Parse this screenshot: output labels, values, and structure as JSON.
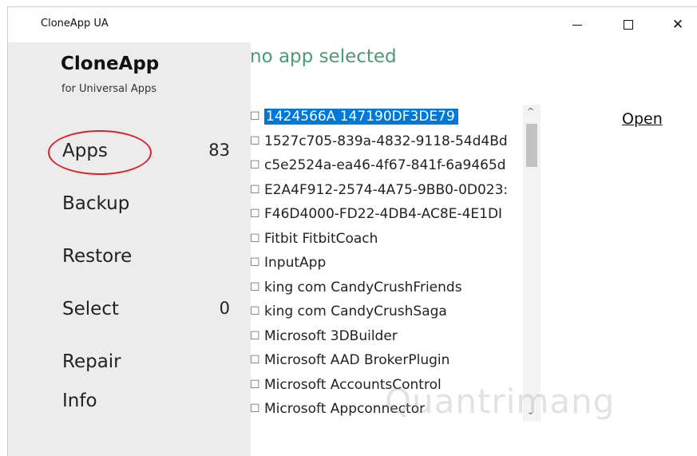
{
  "window": {
    "title": "CloneApp UA",
    "controls": {
      "minimize": "minimize-icon",
      "maximize": "maximize-icon",
      "close": "close-icon",
      "close_glyph": "✕"
    }
  },
  "sidebar": {
    "brand_title": "CloneApp",
    "brand_subtitle": "for Universal Apps",
    "items": [
      {
        "label": "Apps",
        "count": "83"
      },
      {
        "label": "Backup",
        "count": ""
      },
      {
        "label": "Restore",
        "count": ""
      },
      {
        "label": "Select",
        "count": "0"
      },
      {
        "label": "Repair",
        "count": ""
      },
      {
        "label": "Info",
        "count": ""
      }
    ],
    "highlight_color": "#d8222b"
  },
  "main": {
    "status": "no app selected",
    "status_color": "#4a9a78",
    "open_link": "Open",
    "checkbox_glyph": "☐",
    "scroll_up_glyph": "^",
    "scroll_down_glyph": "⌄",
    "apps": [
      {
        "label": "1424566A 147190DF3DE79",
        "selected": true,
        "checked": false
      },
      {
        "label": "1527c705-839a-4832-9118-54d4Bd",
        "selected": false,
        "checked": false
      },
      {
        "label": "c5e2524a-ea46-4f67-841f-6a9465d",
        "selected": false,
        "checked": false
      },
      {
        "label": "E2A4F912-2574-4A75-9BB0-0D023:",
        "selected": false,
        "checked": false
      },
      {
        "label": "F46D4000-FD22-4DB4-AC8E-4E1DI",
        "selected": false,
        "checked": false
      },
      {
        "label": "Fitbit FitbitCoach",
        "selected": false,
        "checked": false
      },
      {
        "label": "InputApp",
        "selected": false,
        "checked": false
      },
      {
        "label": "king com CandyCrushFriends",
        "selected": false,
        "checked": false
      },
      {
        "label": "king com CandyCrushSaga",
        "selected": false,
        "checked": false
      },
      {
        "label": "Microsoft 3DBuilder",
        "selected": false,
        "checked": false
      },
      {
        "label": "Microsoft AAD BrokerPlugin",
        "selected": false,
        "checked": false
      },
      {
        "label": "Microsoft AccountsControl",
        "selected": false,
        "checked": false
      },
      {
        "label": "Microsoft Appconnector",
        "selected": false,
        "checked": false
      }
    ],
    "selection_color": "#0078d7"
  },
  "watermark": "Quantrimang"
}
